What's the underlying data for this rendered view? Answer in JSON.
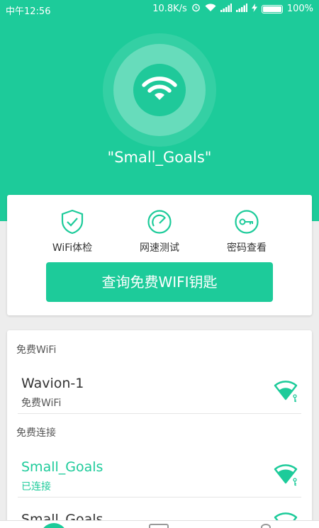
{
  "status_bar": {
    "time": "中午12:56",
    "speed": "10.8K/s",
    "battery": "100%",
    "icons": [
      "alarm-icon",
      "wifi-icon",
      "signal-icon",
      "signal-icon",
      "charging-icon",
      "battery-icon"
    ]
  },
  "hero": {
    "ssid": "\"Small_Goals\"",
    "icon": "wifi-icon"
  },
  "tools": {
    "items": [
      {
        "label": "WiFi体检",
        "icon": "shield-check-icon"
      },
      {
        "label": "网速测试",
        "icon": "speedometer-icon"
      },
      {
        "label": "密码查看",
        "icon": "key-icon"
      }
    ],
    "query_button": "查询免费WIFI钥匙"
  },
  "list": {
    "section_free_wifi": "免费WiFi",
    "section_free_connect": "免费连接",
    "networks": [
      {
        "name": "Wavion-1",
        "status": "免费WiFi",
        "icon": "wifi-key-icon"
      },
      {
        "name": "Small_Goals",
        "status": "已连接",
        "icon": "wifi-key-icon"
      },
      {
        "name": "Small_Goals",
        "status": "",
        "icon": "wifi-key-icon"
      }
    ]
  },
  "colors": {
    "accent": "#1dcb9a",
    "background": "#ededed",
    "card": "#ffffff",
    "text": "#333333"
  }
}
